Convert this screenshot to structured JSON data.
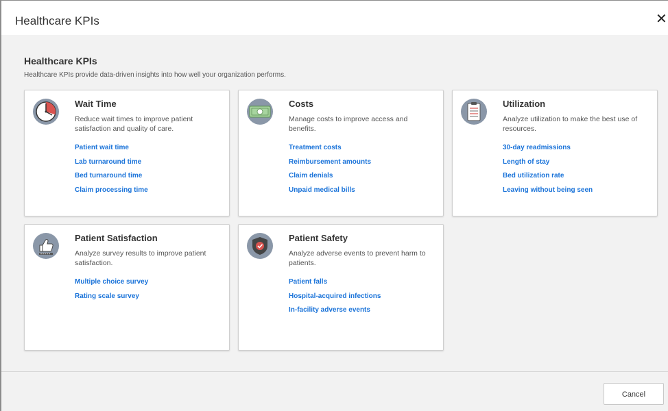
{
  "dialog": {
    "title": "Healthcare KPIs",
    "close_icon": "close-icon"
  },
  "main": {
    "heading": "Healthcare KPIs",
    "description": "Healthcare KPIs provide data-driven insights into how well your organization performs."
  },
  "cards": [
    {
      "title": "Wait Time",
      "description": "Reduce wait times to improve patient satisfaction and quality of care.",
      "icon": "clock-icon",
      "links": [
        "Patient wait time",
        "Lab turnaround time",
        "Bed turnaround time",
        "Claim processing time"
      ]
    },
    {
      "title": "Costs",
      "description": "Manage costs to improve access and benefits.",
      "icon": "money-icon",
      "links": [
        "Treatment costs",
        "Reimbursement amounts",
        "Claim denials",
        "Unpaid medical bills"
      ]
    },
    {
      "title": "Utilization",
      "description": "Analyze utilization to make the best use of resources.",
      "icon": "clipboard-icon",
      "links": [
        "30-day readmissions",
        "Length of stay",
        "Bed utilization rate",
        "Leaving without being seen"
      ]
    },
    {
      "title": "Patient Satisfaction",
      "description": "Analyze survey results to improve patient satisfaction.",
      "icon": "thumbs-up-icon",
      "links": [
        "Multiple choice survey",
        "Rating scale survey"
      ]
    },
    {
      "title": "Patient Safety",
      "description": "Analyze adverse events to prevent harm to patients.",
      "icon": "shield-check-icon",
      "links": [
        "Patient falls",
        "Hospital-acquired infections",
        "In-facility adverse events"
      ]
    }
  ],
  "footer": {
    "cancel_label": "Cancel"
  },
  "colors": {
    "link": "#1a73d9",
    "icon_bg": "#8a97a8",
    "accent_red": "#d9534f"
  }
}
